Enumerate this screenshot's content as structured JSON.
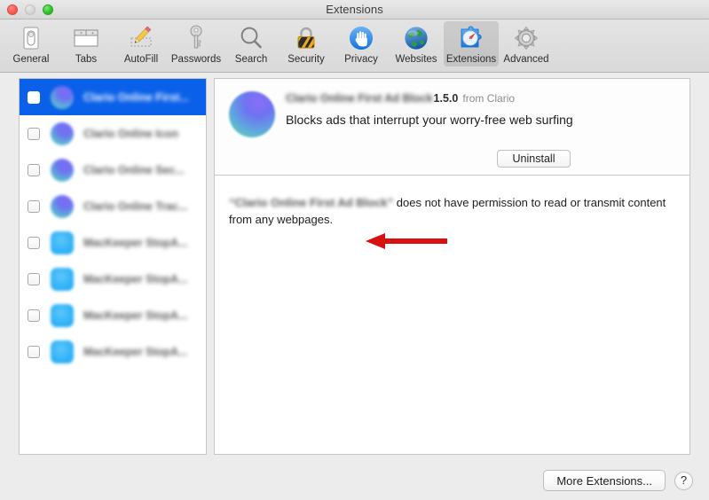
{
  "window": {
    "title": "Extensions",
    "traffic_lights": [
      "close",
      "minimize",
      "maximize"
    ]
  },
  "toolbar": {
    "items": [
      {
        "label": "General",
        "icon": "general-toggle-icon",
        "selected": false
      },
      {
        "label": "Tabs",
        "icon": "tabs-window-icon",
        "selected": false
      },
      {
        "label": "AutoFill",
        "icon": "autofill-pencil-icon",
        "selected": false
      },
      {
        "label": "Passwords",
        "icon": "passwords-key-icon",
        "selected": false
      },
      {
        "label": "Search",
        "icon": "search-magnifier-icon",
        "selected": false
      },
      {
        "label": "Security",
        "icon": "security-lock-icon",
        "selected": false
      },
      {
        "label": "Privacy",
        "icon": "privacy-hand-icon",
        "selected": false
      },
      {
        "label": "Websites",
        "icon": "websites-globe-icon",
        "selected": false
      },
      {
        "label": "Extensions",
        "icon": "extensions-puzzle-icon",
        "selected": true
      },
      {
        "label": "Advanced",
        "icon": "advanced-gear-icon",
        "selected": false
      }
    ]
  },
  "sidebar": {
    "items": [
      {
        "name": "Clario Online First...",
        "icon_shape": "sphere",
        "checked": false,
        "selected": true
      },
      {
        "name": "Clario Online Icon",
        "icon_shape": "sphere",
        "checked": false,
        "selected": false
      },
      {
        "name": "Clario Online Sec...",
        "icon_shape": "sphere",
        "checked": false,
        "selected": false
      },
      {
        "name": "Clario Online Trac...",
        "icon_shape": "sphere",
        "checked": false,
        "selected": false
      },
      {
        "name": "MacKeeper StopA...",
        "icon_shape": "square",
        "checked": false,
        "selected": false
      },
      {
        "name": "MacKeeper StopA...",
        "icon_shape": "square",
        "checked": false,
        "selected": false
      },
      {
        "name": "MacKeeper StopA...",
        "icon_shape": "square",
        "checked": false,
        "selected": false
      },
      {
        "name": "MacKeeper StopA...",
        "icon_shape": "square",
        "checked": false,
        "selected": false
      }
    ]
  },
  "detail": {
    "extension_name": "Clario Online First Ad Block",
    "version": "1.5.0",
    "vendor": "from Clario",
    "description": "Blocks ads that interrupt your worry-free web surfing",
    "uninstall_label": "Uninstall",
    "permission_name": "“Clario Online First Ad Block”",
    "permission_text": " does not have permission to read or transmit content from any webpages."
  },
  "annotation": {
    "arrow_color": "#d81010",
    "arrow_direction": "left",
    "points_at": "uninstall-button"
  },
  "footer": {
    "more_extensions_label": "More Extensions...",
    "help_label": "?"
  },
  "colors": {
    "selection_blue": "#0a60e8",
    "window_chrome": "#ececec",
    "panel_white": "#ffffff",
    "panel_border": "#c6c6c6"
  }
}
